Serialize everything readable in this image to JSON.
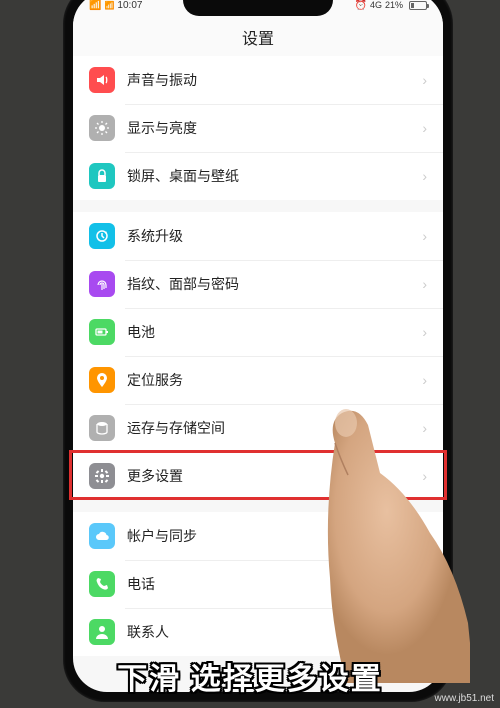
{
  "status": {
    "signal": "4G",
    "time": "10:07",
    "network": "4G",
    "battery_pct": "21%",
    "battery_level": 21
  },
  "header": {
    "title": "设置"
  },
  "groups": [
    {
      "items": [
        {
          "key": "sound",
          "label": "声音与振动",
          "icon_color": "#ff4d4f"
        },
        {
          "key": "display",
          "label": "显示与亮度",
          "icon_color": "#b0b0b0"
        },
        {
          "key": "lock",
          "label": "锁屏、桌面与壁纸",
          "icon_color": "#1fc7c0"
        }
      ]
    },
    {
      "items": [
        {
          "key": "system-update",
          "label": "系统升级",
          "icon_color": "#12c0e8"
        },
        {
          "key": "biometrics",
          "label": "指纹、面部与密码",
          "icon_color": "#a84af0"
        },
        {
          "key": "battery",
          "label": "电池",
          "icon_color": "#4cd964"
        },
        {
          "key": "location",
          "label": "定位服务",
          "icon_color": "#ff9500"
        },
        {
          "key": "storage",
          "label": "运存与存储空间",
          "icon_color": "#b0b0b0"
        },
        {
          "key": "more-settings",
          "label": "更多设置",
          "icon_color": "#8e8e93",
          "highlighted": true
        }
      ]
    },
    {
      "items": [
        {
          "key": "accounts",
          "label": "帐户与同步",
          "icon_color": "#5ac8fa"
        },
        {
          "key": "phone",
          "label": "电话",
          "icon_color": "#4cd964"
        },
        {
          "key": "contacts",
          "label": "联系人",
          "icon_color": "#4cd964"
        }
      ]
    }
  ],
  "caption": "下滑 选择更多设置",
  "watermark": "www.jb51.net",
  "icons": {
    "sound": "volume",
    "display": "brightness",
    "lock": "lock",
    "system-update": "update",
    "biometrics": "fingerprint",
    "battery": "battery",
    "location": "pin",
    "storage": "disk",
    "more-settings": "gear",
    "accounts": "cloud",
    "phone": "phone",
    "contacts": "contact"
  }
}
